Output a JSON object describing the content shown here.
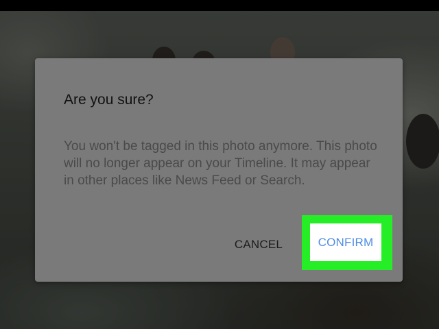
{
  "dialog": {
    "title": "Are you sure?",
    "message": "You won't be tagged in this photo anymore. This photo will no longer appear on your Timeline. It may appear in other places like News Feed or Search.",
    "cancel_label": "CANCEL",
    "confirm_label": "CONFIRM"
  },
  "colors": {
    "highlight": "#26ee26",
    "confirm_text": "#4f8de2",
    "dialog_background": "#7a7a7a"
  }
}
